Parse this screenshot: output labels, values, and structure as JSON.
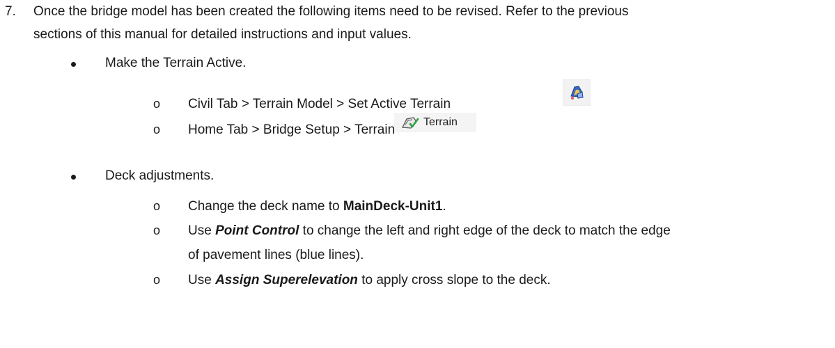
{
  "step": {
    "number": "7.",
    "text_line1": "Once the bridge model has been created the following items need to be revised. Refer to the previous",
    "text_line2": "sections of this manual for detailed instructions and input values."
  },
  "bullets": [
    {
      "text": "Make the Terrain Active.",
      "sub_items": [
        {
          "marker": "o",
          "text": "Civil Tab > Terrain Model > Set Active Terrain",
          "icon": "set-active-terrain-icon"
        },
        {
          "marker": "o",
          "text": "Home Tab > Bridge Setup > Terrain",
          "icon": "terrain-icon",
          "button_label": "Terrain"
        }
      ]
    },
    {
      "text": "Deck adjustments.",
      "sub_items": [
        {
          "marker": "o",
          "prefix": "Change the deck name to ",
          "emphasis": "MainDeck-Unit1",
          "suffix": "."
        },
        {
          "marker": "o",
          "prefix": "Use ",
          "emphasis": "Point Control",
          "suffix": " to change the left and right edge of the deck to match the edge",
          "continuation": "of pavement lines (blue lines)."
        },
        {
          "marker": "o",
          "prefix": "Use ",
          "emphasis": "Assign Superelevation",
          "suffix": " to apply cross slope to the deck."
        }
      ]
    }
  ]
}
